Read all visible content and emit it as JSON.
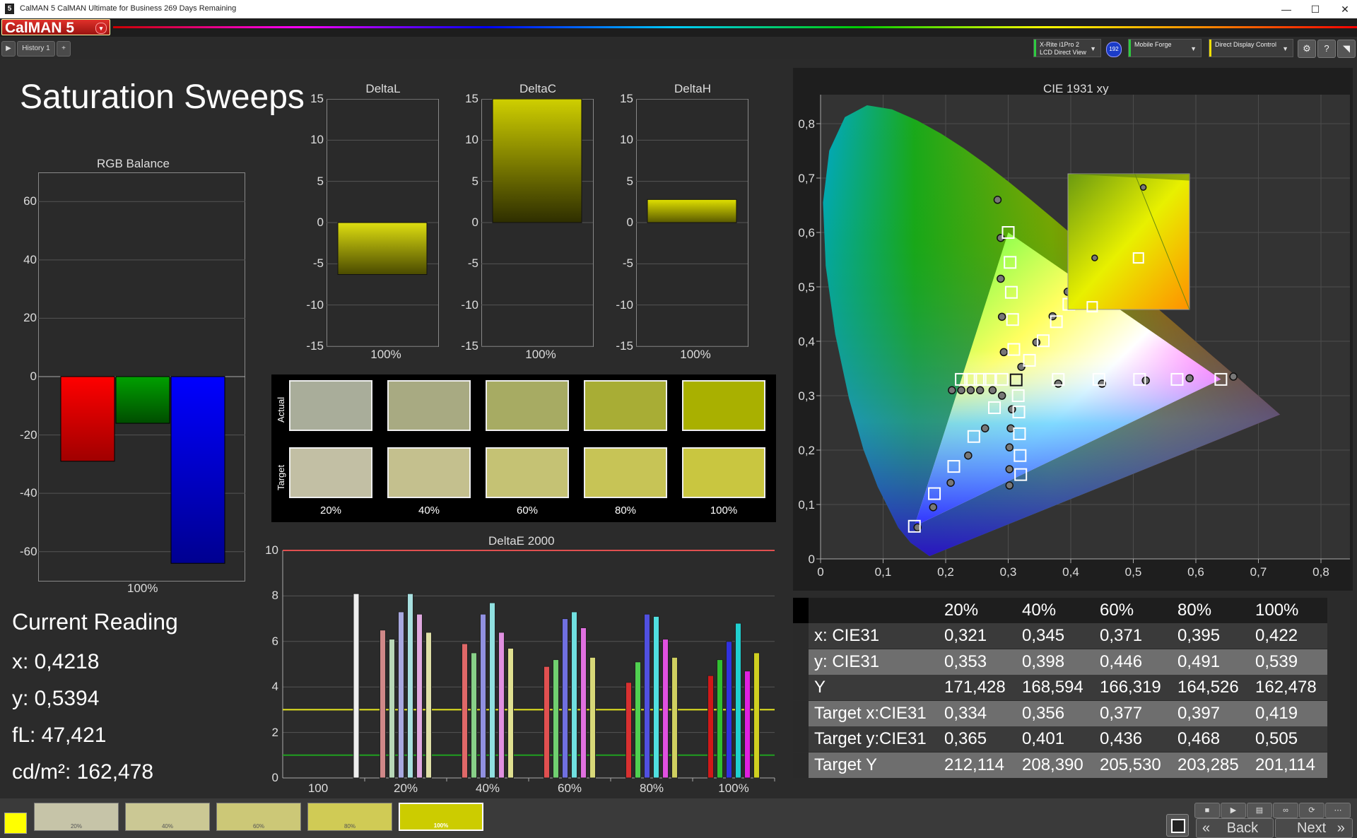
{
  "window": {
    "title": "CalMAN 5 CalMAN Ultimate for Business 269 Days Remaining",
    "logo_letter": "5",
    "min": "—",
    "max": "☐",
    "close": "✕"
  },
  "brand": {
    "label": "CalMAN 5"
  },
  "tabs": {
    "play": "▶",
    "history": "History 1",
    "add": "+"
  },
  "devices": [
    {
      "line1": "X-Rite i1Pro 2",
      "line2": "LCD Direct View",
      "color": "#2ecc40"
    },
    {
      "badge": "192"
    },
    {
      "line1": "Mobile Forge",
      "line2": "",
      "color": "#2ecc40"
    },
    {
      "line1": "Direct Display Control",
      "line2": "",
      "color": "#f4e000"
    }
  ],
  "page_title": "Saturation Sweeps",
  "rgb_balance": {
    "title": "RGB Balance",
    "ticks": [
      "60",
      "40",
      "20",
      "0",
      "-20",
      "-40",
      "-60"
    ],
    "xlabel": "100%",
    "values": {
      "red": -29,
      "green": -16,
      "blue": -64
    }
  },
  "delta_charts": [
    {
      "title": "DeltaL",
      "value": -6.3,
      "xlabel": "100%"
    },
    {
      "title": "DeltaC",
      "value": 15.5,
      "xlabel": "100%"
    },
    {
      "title": "DeltaH",
      "value": 2.8,
      "xlabel": "100%"
    }
  ],
  "delta_ticks": [
    "15",
    "10",
    "5",
    "0",
    "-5",
    "-10",
    "-15"
  ],
  "swatches": {
    "actual_label": "Actual",
    "target_label": "Target",
    "labels": [
      "20%",
      "40%",
      "60%",
      "80%",
      "100%"
    ],
    "actual": [
      "#a9ad9a",
      "#a8aa82",
      "#a7ab63",
      "#a8ad35",
      "#a9b000"
    ],
    "target": [
      "#c2bfa4",
      "#c4c08e",
      "#c5c274",
      "#c7c456",
      "#c9c640"
    ]
  },
  "deltae": {
    "title": "DeltaE 2000",
    "yticks": [
      "10",
      "8",
      "6",
      "4",
      "2",
      "0"
    ],
    "xlabels": [
      "100",
      "20%",
      "40%",
      "60%",
      "80%",
      "100%"
    ],
    "reference_lines": {
      "red": 10,
      "yellow": 3,
      "green": 1
    },
    "groups": [
      {
        "bars": [
          {
            "v": 8.1,
            "c": "#eeeeee"
          }
        ]
      },
      {
        "bars": [
          {
            "v": 6.5,
            "c": "#d08888"
          },
          {
            "v": 6.1,
            "c": "#b8d8b8"
          },
          {
            "v": 7.3,
            "c": "#a8a8e0"
          },
          {
            "v": 8.1,
            "c": "#a8e0e0"
          },
          {
            "v": 7.2,
            "c": "#e0a8e0"
          },
          {
            "v": 6.4,
            "c": "#e0e0a8"
          }
        ]
      },
      {
        "bars": [
          {
            "v": 5.9,
            "c": "#e06868"
          },
          {
            "v": 5.5,
            "c": "#88d088"
          },
          {
            "v": 7.2,
            "c": "#9090e0"
          },
          {
            "v": 7.7,
            "c": "#90e0e0"
          },
          {
            "v": 6.4,
            "c": "#e090e0"
          },
          {
            "v": 5.7,
            "c": "#e0e090"
          }
        ]
      },
      {
        "bars": [
          {
            "v": 4.9,
            "c": "#e05050"
          },
          {
            "v": 5.2,
            "c": "#70d070"
          },
          {
            "v": 7.0,
            "c": "#7070e0"
          },
          {
            "v": 7.3,
            "c": "#70e0e0"
          },
          {
            "v": 6.6,
            "c": "#e070e0"
          },
          {
            "v": 5.3,
            "c": "#d8d878"
          }
        ]
      },
      {
        "bars": [
          {
            "v": 4.2,
            "c": "#d83030"
          },
          {
            "v": 5.1,
            "c": "#50d050"
          },
          {
            "v": 7.2,
            "c": "#5050e0"
          },
          {
            "v": 7.1,
            "c": "#50e0e0"
          },
          {
            "v": 6.1,
            "c": "#e050e0"
          },
          {
            "v": 5.3,
            "c": "#d0d060"
          }
        ]
      },
      {
        "bars": [
          {
            "v": 4.5,
            "c": "#d01818"
          },
          {
            "v": 5.2,
            "c": "#30c030"
          },
          {
            "v": 6.0,
            "c": "#3030e0"
          },
          {
            "v": 6.8,
            "c": "#20d0d0"
          },
          {
            "v": 4.7,
            "c": "#e020e0"
          },
          {
            "v": 5.5,
            "c": "#d0d020"
          }
        ]
      }
    ]
  },
  "cie": {
    "title": "CIE 1931 xy",
    "xticks": [
      "0",
      "0,1",
      "0,2",
      "0,3",
      "0,4",
      "0,5",
      "0,6",
      "0,7",
      "0,8"
    ],
    "yticks": [
      "0",
      "0,1",
      "0,2",
      "0,3",
      "0,4",
      "0,5",
      "0,6",
      "0,7",
      "0,8"
    ],
    "targets": [
      [
        0.64,
        0.33
      ],
      [
        0.57,
        0.33
      ],
      [
        0.51,
        0.33
      ],
      [
        0.445,
        0.33
      ],
      [
        0.38,
        0.33
      ],
      [
        0.3,
        0.6
      ],
      [
        0.303,
        0.545
      ],
      [
        0.305,
        0.49
      ],
      [
        0.307,
        0.44
      ],
      [
        0.309,
        0.385
      ],
      [
        0.15,
        0.06
      ],
      [
        0.182,
        0.12
      ],
      [
        0.213,
        0.17
      ],
      [
        0.245,
        0.225
      ],
      [
        0.278,
        0.278
      ],
      [
        0.3127,
        0.329
      ],
      [
        0.32,
        0.155
      ],
      [
        0.319,
        0.19
      ],
      [
        0.318,
        0.23
      ],
      [
        0.317,
        0.27
      ],
      [
        0.316,
        0.3
      ],
      [
        0.225,
        0.33
      ],
      [
        0.24,
        0.33
      ],
      [
        0.255,
        0.33
      ],
      [
        0.27,
        0.33
      ],
      [
        0.29,
        0.33
      ],
      [
        0.419,
        0.505
      ],
      [
        0.397,
        0.468
      ],
      [
        0.377,
        0.436
      ],
      [
        0.356,
        0.401
      ],
      [
        0.334,
        0.365
      ]
    ],
    "actuals": [
      [
        0.66,
        0.335
      ],
      [
        0.59,
        0.332
      ],
      [
        0.52,
        0.328
      ],
      [
        0.45,
        0.322
      ],
      [
        0.38,
        0.322
      ],
      [
        0.283,
        0.66
      ],
      [
        0.288,
        0.59
      ],
      [
        0.288,
        0.515
      ],
      [
        0.29,
        0.445
      ],
      [
        0.293,
        0.38
      ],
      [
        0.155,
        0.058
      ],
      [
        0.18,
        0.095
      ],
      [
        0.208,
        0.14
      ],
      [
        0.236,
        0.19
      ],
      [
        0.263,
        0.24
      ],
      [
        0.29,
        0.3
      ],
      [
        0.302,
        0.135
      ],
      [
        0.302,
        0.165
      ],
      [
        0.302,
        0.205
      ],
      [
        0.304,
        0.24
      ],
      [
        0.306,
        0.275
      ],
      [
        0.21,
        0.31
      ],
      [
        0.225,
        0.31
      ],
      [
        0.24,
        0.31
      ],
      [
        0.255,
        0.31
      ],
      [
        0.275,
        0.31
      ],
      [
        0.422,
        0.539
      ],
      [
        0.395,
        0.491
      ],
      [
        0.371,
        0.446
      ],
      [
        0.345,
        0.398
      ],
      [
        0.321,
        0.353
      ]
    ],
    "inset_targets": [
      [
        0.58,
        0.38
      ],
      [
        0.2,
        0.02
      ]
    ],
    "inset_actuals": [
      [
        0.62,
        0.9
      ],
      [
        0.22,
        0.38
      ]
    ]
  },
  "current_reading": {
    "title": "Current Reading",
    "x": "x: 0,4218",
    "y": "y: 0,5394",
    "fl": "fL: 47,421",
    "cdm2": "cd/m²: 162,478"
  },
  "table": {
    "headers": [
      "20%",
      "40%",
      "60%",
      "80%",
      "100%"
    ],
    "rows": [
      {
        "label": "x: CIE31",
        "values": [
          "0,321",
          "0,345",
          "0,371",
          "0,395",
          "0,422"
        ]
      },
      {
        "label": "y: CIE31",
        "values": [
          "0,353",
          "0,398",
          "0,446",
          "0,491",
          "0,539"
        ]
      },
      {
        "label": "Y",
        "values": [
          "171,428",
          "168,594",
          "166,319",
          "164,526",
          "162,478"
        ]
      },
      {
        "label": "Target x:CIE31",
        "values": [
          "0,334",
          "0,356",
          "0,377",
          "0,397",
          "0,419"
        ]
      },
      {
        "label": "Target y:CIE31",
        "values": [
          "0,365",
          "0,401",
          "0,436",
          "0,468",
          "0,505"
        ]
      },
      {
        "label": "Target Y",
        "values": [
          "212,114",
          "208,390",
          "205,530",
          "203,285",
          "201,114"
        ]
      }
    ]
  },
  "bottom": {
    "current_color": "#ffff00",
    "steps": [
      {
        "label": "20%",
        "color": "#c6c4a8"
      },
      {
        "label": "40%",
        "color": "#cbc894"
      },
      {
        "label": "60%",
        "color": "#ccc877"
      },
      {
        "label": "80%",
        "color": "#d0cb55"
      },
      {
        "label": "100%",
        "color": "#cccc00"
      }
    ],
    "back": "Back",
    "next": "Next"
  }
}
